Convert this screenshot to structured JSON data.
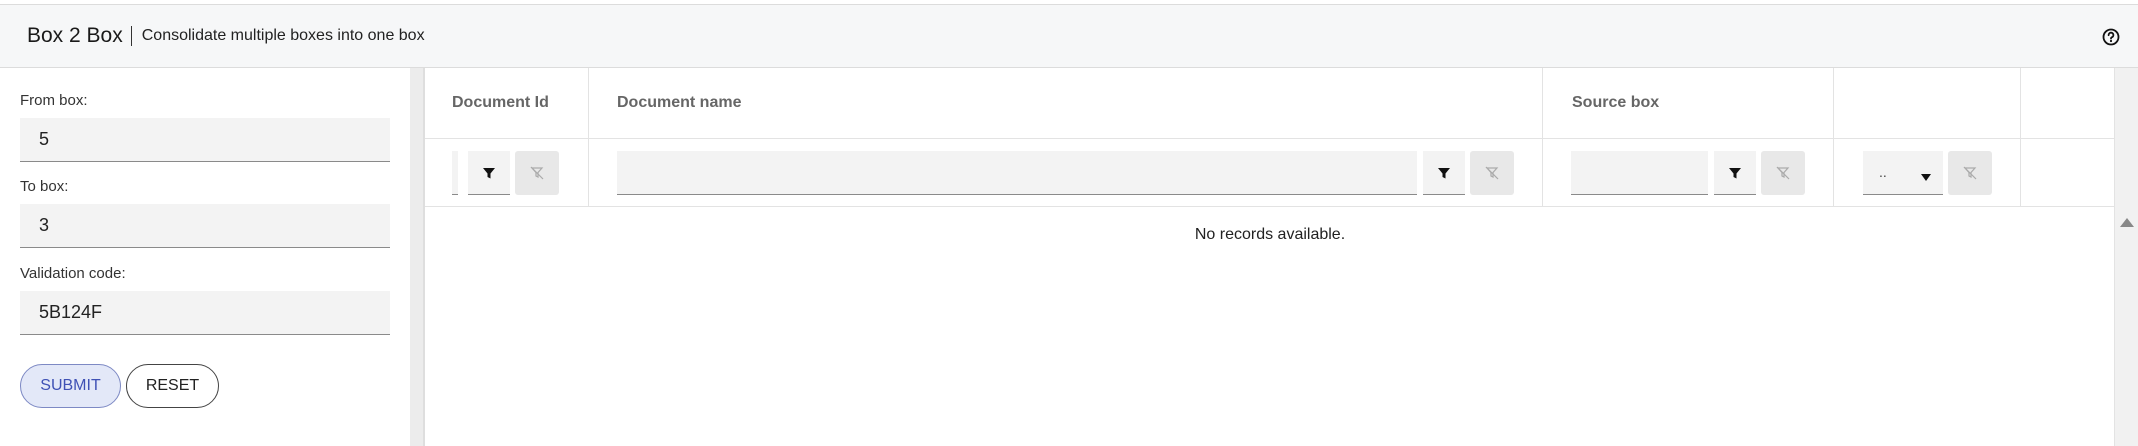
{
  "header": {
    "title": "Box 2 Box",
    "subtitle": "Consolidate multiple boxes into one box",
    "help_icon": "help-circle-icon"
  },
  "form": {
    "from_box": {
      "label": "From box:",
      "value": "5"
    },
    "to_box": {
      "label": "To box:",
      "value": "3"
    },
    "validation_code": {
      "label": "Validation code:",
      "value": "5B124F"
    },
    "submit_label": "SUBMIT",
    "reset_label": "RESET"
  },
  "grid": {
    "columns": [
      {
        "title": "Document Id"
      },
      {
        "title": "Document name"
      },
      {
        "title": "Source box"
      },
      {
        "title": ""
      }
    ],
    "select_filter_value": "..",
    "empty_message": "No records available.",
    "icons": {
      "filter": "filter-icon",
      "clear_filter": "clear-filter-icon",
      "dropdown": "caret-down-icon",
      "scroll_up": "scroll-up-icon"
    }
  },
  "colors": {
    "accent": "#3f51b5",
    "submit_bg": "#e3e8f8",
    "header_bg": "#f6f7f8"
  }
}
